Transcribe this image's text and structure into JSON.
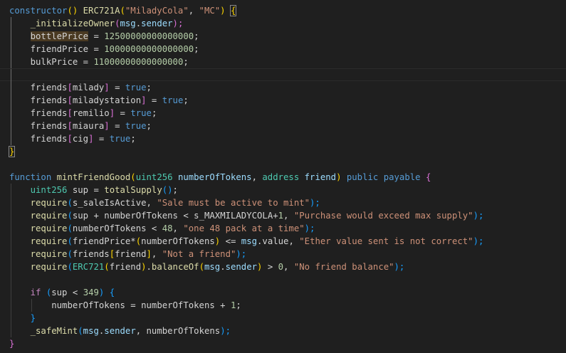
{
  "code": {
    "l1": {
      "kw_constructor": "constructor",
      "p_open": "(",
      "p_close": ")",
      "call": "ERC721A",
      "a_open": "(",
      "s_name": "\"MiladyCola\"",
      "comma": ", ",
      "s_symbol": "\"MC\"",
      "a_close": ")",
      "brace": "{"
    },
    "l2": {
      "fn": "_initializeOwner",
      "open": "(",
      "msg": "msg",
      "dot": ".",
      "sender": "sender",
      "close": ");"
    },
    "l3": {
      "var": "bottlePrice",
      "eq": " = ",
      "num": "12500000000000000",
      "semi": ";"
    },
    "l4": {
      "var": "friendPrice",
      "eq": " = ",
      "num": "10000000000000000",
      "semi": ";"
    },
    "l5": {
      "var": "bulkPrice",
      "eq": " = ",
      "num": "11000000000000000",
      "semi": ";"
    },
    "friends_lines": [
      {
        "map": "friends",
        "open": "[",
        "key": "milady",
        "close": "]",
        "eq": " = ",
        "val": "true",
        "semi": ";"
      },
      {
        "map": "friends",
        "open": "[",
        "key": "miladystation",
        "close": "]",
        "eq": " = ",
        "val": "true",
        "semi": ";"
      },
      {
        "map": "friends",
        "open": "[",
        "key": "remilio",
        "close": "]",
        "eq": " = ",
        "val": "true",
        "semi": ";"
      },
      {
        "map": "friends",
        "open": "[",
        "key": "miaura",
        "close": "]",
        "eq": " = ",
        "val": "true",
        "semi": ";"
      },
      {
        "map": "friends",
        "open": "[",
        "key": "cig",
        "close": "]",
        "eq": " = ",
        "val": "true",
        "semi": ";"
      }
    ],
    "l12": {
      "brace": "}"
    },
    "l14": {
      "kw": "function",
      "name": "mintFriendGood",
      "open": "(",
      "t1": "uint256",
      "p1": "numberOfTokens",
      "comma": ", ",
      "t2": "address",
      "p2": "friend",
      "close": ")",
      "vis": "public",
      "mut": "payable",
      "brace": "{"
    },
    "l15": {
      "type": "uint256",
      "var": "sup",
      "eq": " = ",
      "fn": "totalSupply",
      "call": "()",
      "semi": ";"
    },
    "l16": {
      "fn": "require",
      "open": "(",
      "var": "s_saleIsActive",
      "comma": ", ",
      "str": "\"Sale must be active to mint\"",
      "close": ");"
    },
    "l17": {
      "fn": "require",
      "open": "(",
      "a": "sup",
      "plus": " + ",
      "b": "numberOfTokens",
      "lt": " < ",
      "c": "s_MAXMILADYCOLA",
      "plus2": "+",
      "one": "1",
      "comma": ", ",
      "str": "\"Purchase would exceed max supply\"",
      "close": ");"
    },
    "l18": {
      "fn": "require",
      "open": "(",
      "a": "numberOfTokens",
      "lt": " < ",
      "n": "48",
      "comma": ", ",
      "str": "\"one 48 pack at a time\"",
      "close": ");"
    },
    "l19": {
      "fn": "require",
      "open": "(",
      "a": "friendPrice",
      "mul": "*",
      "p_open": "(",
      "b": "numberOfTokens",
      "p_close": ")",
      "le": " <= ",
      "msg": "msg",
      "dot": ".",
      "value": "value",
      "comma": ", ",
      "str": "\"Ether value sent is not correct\"",
      "close": ");"
    },
    "l20": {
      "fn": "require",
      "open": "(",
      "map": "friends",
      "b_open": "[",
      "key": "friend",
      "b_close": "]",
      "comma": ", ",
      "str": "\"Not a friend\"",
      "close": ");"
    },
    "l21": {
      "fn": "require",
      "open": "(",
      "cast": "ERC721",
      "c_open": "(",
      "arg": "friend",
      "c_close": ")",
      "dot": ".",
      "method": "balanceOf",
      "m_open": "(",
      "msg": "msg",
      "dot2": ".",
      "sender": "sender",
      "m_close": ")",
      "gt": " > ",
      "zero": "0",
      "comma": ", ",
      "str": "\"No friend balance\"",
      "close": ");"
    },
    "l23": {
      "kw": "if",
      "sp": " ",
      "open": "(",
      "a": "sup",
      "lt": " < ",
      "n": "349",
      "close": ")",
      "brace": " {"
    },
    "l24": {
      "a": "numberOfTokens",
      "eq": " = ",
      "b": "numberOfTokens",
      "plus": " + ",
      "one": "1",
      "semi": ";"
    },
    "l25": {
      "brace": "}"
    },
    "l26": {
      "fn": "_safeMint",
      "open": "(",
      "msg": "msg",
      "dot": ".",
      "sender": "sender",
      "comma": ", ",
      "b": "numberOfTokens",
      "close": ");"
    },
    "l27": {
      "brace": "}"
    }
  },
  "colors": {
    "background": "#1f1f1f",
    "keyword": "#569cd6",
    "control": "#c586c0",
    "function": "#dcdcaa",
    "type": "#4ec9b0",
    "variable": "#9cdcfe",
    "string": "#ce9178",
    "number": "#b5cea8",
    "bracket_gold": "#ffd700",
    "bracket_orchid": "#da70d6",
    "bracket_blue": "#179fff"
  }
}
